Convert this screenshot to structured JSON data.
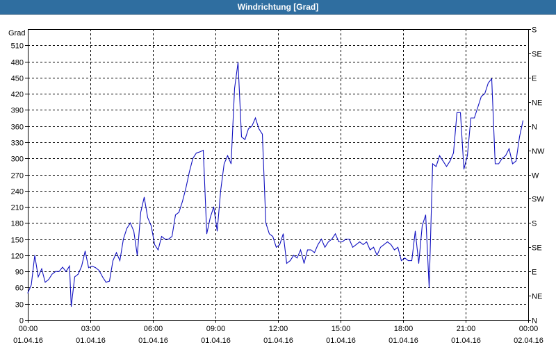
{
  "window": {
    "title": "Windrichtung [Grad]"
  },
  "chart_data": {
    "type": "line",
    "title": "Windrichtung [Grad]",
    "ylabel": "Grad",
    "ylim": [
      0,
      540
    ],
    "xlim": [
      "01.04.16 00:00",
      "02.04.16 00:00"
    ],
    "grid": true,
    "x_ticks": [
      {
        "time": "00:00",
        "date": "01.04.16"
      },
      {
        "time": "03:00",
        "date": "01.04.16"
      },
      {
        "time": "06:00",
        "date": "01.04.16"
      },
      {
        "time": "09:00",
        "date": "01.04.16"
      },
      {
        "time": "12:00",
        "date": "01.04.16"
      },
      {
        "time": "15:00",
        "date": "01.04.16"
      },
      {
        "time": "18:00",
        "date": "01.04.16"
      },
      {
        "time": "21:00",
        "date": "01.04.16"
      },
      {
        "time": "00:00",
        "date": "02.04.16"
      }
    ],
    "y_ticks": [
      0,
      30,
      60,
      90,
      120,
      150,
      180,
      210,
      240,
      270,
      300,
      330,
      360,
      390,
      420,
      450,
      480,
      510
    ],
    "right_labels": [
      {
        "value": 0,
        "label": "N"
      },
      {
        "value": 45,
        "label": "NE"
      },
      {
        "value": 90,
        "label": "E"
      },
      {
        "value": 135,
        "label": "SE"
      },
      {
        "value": 180,
        "label": "S"
      },
      {
        "value": 225,
        "label": "SW"
      },
      {
        "value": 270,
        "label": "W"
      },
      {
        "value": 315,
        "label": "NW"
      },
      {
        "value": 360,
        "label": "N"
      },
      {
        "value": 405,
        "label": "NE"
      },
      {
        "value": 450,
        "label": "E"
      },
      {
        "value": 495,
        "label": "SE"
      },
      {
        "value": 540,
        "label": "S"
      }
    ],
    "series": [
      {
        "color": "#1010c0",
        "points": [
          [
            "00:00",
            50
          ],
          [
            "00:10",
            65
          ],
          [
            "00:20",
            120
          ],
          [
            "00:30",
            80
          ],
          [
            "00:40",
            95
          ],
          [
            "00:50",
            70
          ],
          [
            "01:00",
            75
          ],
          [
            "01:10",
            85
          ],
          [
            "01:20",
            90
          ],
          [
            "01:30",
            90
          ],
          [
            "01:40",
            98
          ],
          [
            "01:50",
            90
          ],
          [
            "02:00",
            100
          ],
          [
            "02:05",
            25
          ],
          [
            "02:15",
            80
          ],
          [
            "02:25",
            85
          ],
          [
            "02:35",
            100
          ],
          [
            "02:45",
            128
          ],
          [
            "02:55",
            97
          ],
          [
            "03:05",
            100
          ],
          [
            "03:15",
            97
          ],
          [
            "03:25",
            92
          ],
          [
            "03:35",
            80
          ],
          [
            "03:45",
            70
          ],
          [
            "03:55",
            72
          ],
          [
            "04:05",
            110
          ],
          [
            "04:15",
            125
          ],
          [
            "04:25",
            110
          ],
          [
            "04:35",
            150
          ],
          [
            "04:45",
            170
          ],
          [
            "04:55",
            180
          ],
          [
            "05:05",
            165
          ],
          [
            "05:15",
            120
          ],
          [
            "05:25",
            200
          ],
          [
            "05:35",
            228
          ],
          [
            "05:45",
            190
          ],
          [
            "05:55",
            175
          ],
          [
            "06:05",
            140
          ],
          [
            "06:15",
            130
          ],
          [
            "06:25",
            155
          ],
          [
            "06:35",
            150
          ],
          [
            "06:45",
            150
          ],
          [
            "06:55",
            155
          ],
          [
            "07:05",
            195
          ],
          [
            "07:15",
            200
          ],
          [
            "07:25",
            220
          ],
          [
            "07:35",
            245
          ],
          [
            "07:45",
            275
          ],
          [
            "07:55",
            300
          ],
          [
            "08:05",
            310
          ],
          [
            "08:15",
            312
          ],
          [
            "08:25",
            315
          ],
          [
            "08:35",
            160
          ],
          [
            "08:45",
            190
          ],
          [
            "08:55",
            210
          ],
          [
            "09:05",
            165
          ],
          [
            "09:15",
            240
          ],
          [
            "09:25",
            290
          ],
          [
            "09:35",
            305
          ],
          [
            "09:45",
            290
          ],
          [
            "09:55",
            430
          ],
          [
            "10:05",
            478
          ],
          [
            "10:15",
            340
          ],
          [
            "10:25",
            335
          ],
          [
            "10:35",
            355
          ],
          [
            "10:45",
            360
          ],
          [
            "10:55",
            375
          ],
          [
            "11:05",
            355
          ],
          [
            "11:15",
            345
          ],
          [
            "11:25",
            180
          ],
          [
            "11:35",
            160
          ],
          [
            "11:45",
            155
          ],
          [
            "11:55",
            135
          ],
          [
            "12:05",
            140
          ],
          [
            "12:15",
            160
          ],
          [
            "12:25",
            105
          ],
          [
            "12:35",
            110
          ],
          [
            "12:45",
            120
          ],
          [
            "12:55",
            115
          ],
          [
            "13:05",
            130
          ],
          [
            "13:15",
            105
          ],
          [
            "13:25",
            130
          ],
          [
            "13:35",
            130
          ],
          [
            "13:45",
            125
          ],
          [
            "13:55",
            140
          ],
          [
            "14:05",
            150
          ],
          [
            "14:15",
            135
          ],
          [
            "14:25",
            145
          ],
          [
            "14:35",
            150
          ],
          [
            "14:45",
            160
          ],
          [
            "14:55",
            145
          ],
          [
            "15:05",
            145
          ],
          [
            "15:15",
            150
          ],
          [
            "15:25",
            150
          ],
          [
            "15:35",
            135
          ],
          [
            "15:45",
            140
          ],
          [
            "15:55",
            145
          ],
          [
            "16:05",
            140
          ],
          [
            "16:15",
            145
          ],
          [
            "16:25",
            130
          ],
          [
            "16:35",
            135
          ],
          [
            "16:45",
            120
          ],
          [
            "16:55",
            135
          ],
          [
            "17:05",
            140
          ],
          [
            "17:15",
            145
          ],
          [
            "17:25",
            140
          ],
          [
            "17:35",
            130
          ],
          [
            "17:45",
            135
          ],
          [
            "17:55",
            110
          ],
          [
            "18:05",
            115
          ],
          [
            "18:15",
            110
          ],
          [
            "18:25",
            110
          ],
          [
            "18:35",
            165
          ],
          [
            "18:45",
            105
          ],
          [
            "18:55",
            175
          ],
          [
            "19:05",
            195
          ],
          [
            "19:15",
            60
          ],
          [
            "19:25",
            290
          ],
          [
            "19:35",
            285
          ],
          [
            "19:45",
            305
          ],
          [
            "19:55",
            295
          ],
          [
            "20:05",
            285
          ],
          [
            "20:15",
            295
          ],
          [
            "20:25",
            310
          ],
          [
            "20:35",
            385
          ],
          [
            "20:45",
            385
          ],
          [
            "20:55",
            280
          ],
          [
            "21:05",
            305
          ],
          [
            "21:15",
            375
          ],
          [
            "21:25",
            375
          ],
          [
            "21:35",
            395
          ],
          [
            "21:45",
            415
          ],
          [
            "21:55",
            420
          ],
          [
            "22:05",
            440
          ],
          [
            "22:15",
            448
          ],
          [
            "22:25",
            290
          ],
          [
            "22:35",
            290
          ],
          [
            "22:45",
            300
          ],
          [
            "22:55",
            305
          ],
          [
            "23:05",
            318
          ],
          [
            "23:15",
            290
          ],
          [
            "23:25",
            295
          ],
          [
            "23:35",
            340
          ],
          [
            "23:45",
            370
          ]
        ]
      }
    ]
  }
}
